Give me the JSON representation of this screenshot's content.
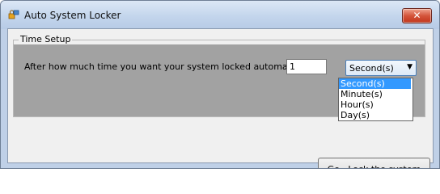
{
  "window": {
    "title": "Auto System Locker",
    "close_glyph": "✕"
  },
  "group": {
    "title": "Time Setup"
  },
  "form": {
    "prompt": "After how much time you want your system locked automatically",
    "time_value": "1",
    "unit_selected": "Second(s)",
    "unit_options": [
      "Second(s)",
      "Minute(s)",
      "Hour(s)",
      "Day(s)"
    ]
  },
  "actions": {
    "lock_label": "Go...Lock the system"
  },
  "colors": {
    "selection": "#3399ff",
    "close_button": "#c2361c",
    "groupbox_fill": "#a2a2a2"
  }
}
